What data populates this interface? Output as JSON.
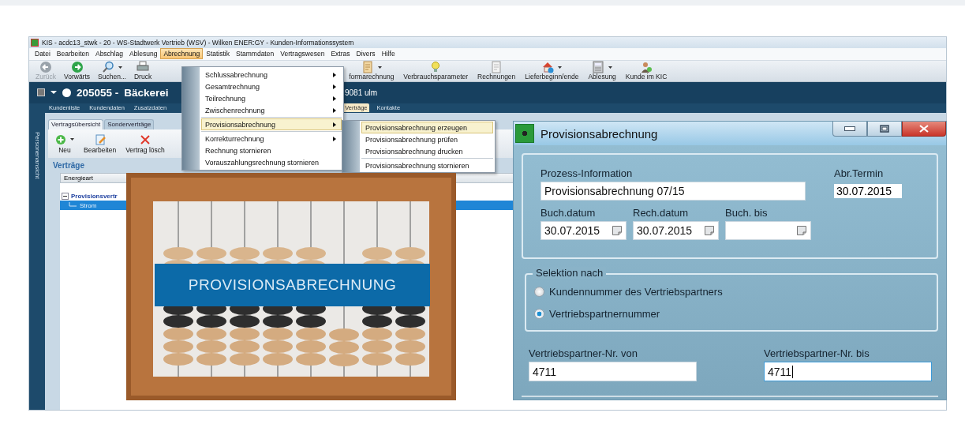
{
  "window": {
    "title": "KIS - acdc13_stwk - 20 - WS-Stadtwerk Vertrieb (WSV) - Wilken ENER:GY - Kunden-Informationssystem"
  },
  "menu_bar": [
    {
      "label": "Datei",
      "selected": false
    },
    {
      "label": "Bearbeiten",
      "selected": false
    },
    {
      "label": "Abschlag",
      "selected": false
    },
    {
      "label": "Ablesung",
      "selected": false
    },
    {
      "label": "Abrechnung",
      "selected": true
    },
    {
      "label": "Statistik",
      "selected": false
    },
    {
      "label": "Stammdaten",
      "selected": false
    },
    {
      "label": "Vertragswesen",
      "selected": false
    },
    {
      "label": "Extras",
      "selected": false
    },
    {
      "label": "Divers",
      "selected": false
    },
    {
      "label": "Hilfe",
      "selected": false
    }
  ],
  "toolbar_left": [
    {
      "label": "Zurück",
      "disabled": true,
      "dropdown": false
    },
    {
      "label": "Vorwärts",
      "disabled": false,
      "dropdown": false
    },
    {
      "label": "Suchen...",
      "disabled": false,
      "dropdown": true
    },
    {
      "label": "Druck",
      "disabled": false,
      "dropdown": false
    }
  ],
  "toolbar_right": [
    {
      "label": "formarechnung",
      "disabled": false,
      "dropdown": true
    },
    {
      "label": "Verbrauchsparameter",
      "disabled": false,
      "dropdown": false
    },
    {
      "label": "Rechnungen",
      "disabled": false,
      "dropdown": false
    },
    {
      "label": "Lieferbeginn/ende",
      "disabled": false,
      "dropdown": true
    },
    {
      "label": "Ablesung",
      "disabled": false,
      "dropdown": true
    },
    {
      "label": "Kunde im KIC",
      "disabled": false,
      "dropdown": false
    }
  ],
  "customer_header": {
    "number": "205055 -",
    "name": "Bäckerei",
    "address": "9081 ulm"
  },
  "nav_tabs_left": [
    {
      "label": "Kundenliste",
      "selected": false
    },
    {
      "label": "Kundendaten",
      "selected": false
    },
    {
      "label": "Zusatzdaten",
      "selected": false
    }
  ],
  "nav_tabs_right": [
    {
      "label": "Verträge",
      "selected": true
    },
    {
      "label": "Kontakte",
      "selected": false
    }
  ],
  "side_panel": {
    "label": "Personenansicht"
  },
  "content": {
    "tabs": [
      {
        "label": "Vertragsübersicht",
        "selected": true
      },
      {
        "label": "Sonderverträge",
        "selected": false
      }
    ],
    "toolbar": [
      {
        "label": "Neu",
        "dropdown": true
      },
      {
        "label": "Bearbeiten",
        "dropdown": false
      },
      {
        "label": "Vertrag lösch",
        "dropdown": false
      }
    ],
    "section_title": "Verträge",
    "table": {
      "columns": [
        "Energieart"
      ],
      "tree": [
        {
          "label": "Provisionsvertr",
          "expanded": true,
          "selected": false,
          "children": [
            {
              "label": "Strom",
              "selected": true
            }
          ]
        }
      ]
    }
  },
  "menu": {
    "items": [
      {
        "kind": "item",
        "label": "Schlussabrechnung",
        "submenu": true,
        "selected": false
      },
      {
        "kind": "item",
        "label": "Gesamtrechnung",
        "submenu": true,
        "selected": false
      },
      {
        "kind": "item",
        "label": "Teilrechnung",
        "submenu": true,
        "selected": false
      },
      {
        "kind": "item",
        "label": "Zwischenrechnung",
        "submenu": true,
        "selected": false
      },
      {
        "kind": "separator"
      },
      {
        "kind": "item",
        "label": "Provisionsabrechnung",
        "submenu": true,
        "selected": true
      },
      {
        "kind": "separator"
      },
      {
        "kind": "item",
        "label": "Korrekturrechnung",
        "submenu": true,
        "selected": false
      },
      {
        "kind": "item",
        "label": "Rechnung stornieren",
        "submenu": false,
        "selected": false
      },
      {
        "kind": "item",
        "label": "Vorauszahlungsrechnung stornieren",
        "submenu": false,
        "selected": false
      }
    ]
  },
  "submenu": {
    "items": [
      {
        "kind": "item",
        "label": "Provisionsabrechnung erzeugen",
        "selected": true
      },
      {
        "kind": "item",
        "label": "Provisionsabrechnung prüfen",
        "selected": false
      },
      {
        "kind": "item",
        "label": "Provisionsabrechnung drucken",
        "selected": false
      },
      {
        "kind": "separator"
      },
      {
        "kind": "item",
        "label": "Provisionsabrechnung stornieren",
        "selected": false
      }
    ]
  },
  "photo": {
    "banner": "PROVISIONSABRECHNUNG"
  },
  "dialog": {
    "title": "Provisionsabrechnung",
    "process": {
      "label": "Prozess-Information",
      "value": "Provisionsabrechnung 07/15"
    },
    "term": {
      "label": "Abr.Termin",
      "value": "30.07.2015"
    },
    "dates": [
      {
        "label": "Buch.datum",
        "value": "30.07.2015"
      },
      {
        "label": "Rech.datum",
        "value": "30.07.2015"
      },
      {
        "label": "Buch. bis"
      }
    ],
    "selection": {
      "title": "Selektion nach",
      "options": [
        {
          "label": "Kundennummer des Vertriebspartners",
          "selected": false
        },
        {
          "label": "Vertriebspartnernummer",
          "selected": true
        }
      ]
    },
    "range": [
      {
        "label": "Vertriebspartner-Nr. von",
        "value": "4711",
        "focused": false
      },
      {
        "label": "Vertriebspartner-Nr. bis",
        "value": "4711",
        "focused": true
      }
    ]
  }
}
